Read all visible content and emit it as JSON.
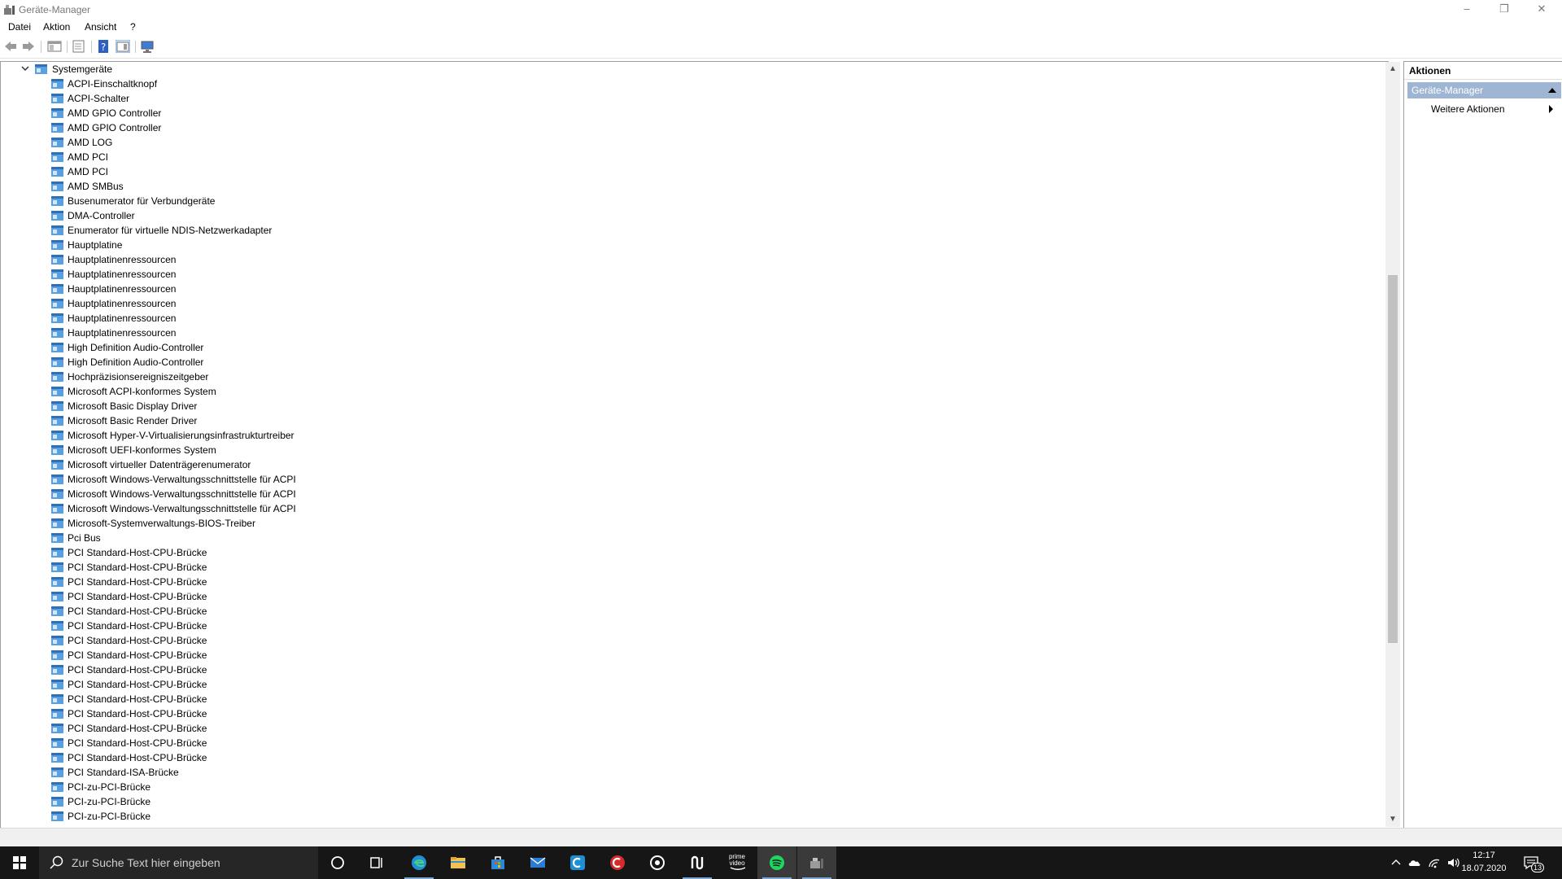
{
  "window": {
    "title": "Geräte-Manager",
    "controls": {
      "minimize": "–",
      "restore": "❐",
      "close": "✕"
    }
  },
  "menu": [
    "Datei",
    "Aktion",
    "Ansicht",
    "?"
  ],
  "toolbar": {
    "icons": [
      "back-icon",
      "forward-icon",
      "show-hide-console-tree-icon",
      "properties-icon",
      "help-icon",
      "show-hide-action-pane-icon",
      "scan-hardware-icon"
    ]
  },
  "tree": {
    "category": "Systemgeräte",
    "expanded": true,
    "devices": [
      "ACPI-Einschaltknopf",
      "ACPI-Schalter",
      "AMD GPIO Controller",
      "AMD GPIO Controller",
      "AMD LOG",
      "AMD PCI",
      "AMD PCI",
      "AMD SMBus",
      "Busenumerator für Verbundgeräte",
      "DMA-Controller",
      "Enumerator für virtuelle NDIS-Netzwerkadapter",
      "Hauptplatine",
      "Hauptplatinenressourcen",
      "Hauptplatinenressourcen",
      "Hauptplatinenressourcen",
      "Hauptplatinenressourcen",
      "Hauptplatinenressourcen",
      "Hauptplatinenressourcen",
      "High Definition Audio-Controller",
      "High Definition Audio-Controller",
      "Hochpräzisionsereigniszeitgeber",
      "Microsoft ACPI-konformes System",
      "Microsoft Basic Display Driver",
      "Microsoft Basic Render Driver",
      "Microsoft Hyper-V-Virtualisierungsinfrastrukturtreiber",
      "Microsoft UEFI-konformes System",
      "Microsoft virtueller Datenträgerenumerator",
      "Microsoft Windows-Verwaltungsschnittstelle für ACPI",
      "Microsoft Windows-Verwaltungsschnittstelle für ACPI",
      "Microsoft Windows-Verwaltungsschnittstelle für ACPI",
      "Microsoft-Systemverwaltungs-BIOS-Treiber",
      "Pci Bus",
      "PCI Standard-Host-CPU-Brücke",
      "PCI Standard-Host-CPU-Brücke",
      "PCI Standard-Host-CPU-Brücke",
      "PCI Standard-Host-CPU-Brücke",
      "PCI Standard-Host-CPU-Brücke",
      "PCI Standard-Host-CPU-Brücke",
      "PCI Standard-Host-CPU-Brücke",
      "PCI Standard-Host-CPU-Brücke",
      "PCI Standard-Host-CPU-Brücke",
      "PCI Standard-Host-CPU-Brücke",
      "PCI Standard-Host-CPU-Brücke",
      "PCI Standard-Host-CPU-Brücke",
      "PCI Standard-Host-CPU-Brücke",
      "PCI Standard-Host-CPU-Brücke",
      "PCI Standard-Host-CPU-Brücke",
      "PCI Standard-ISA-Brücke",
      "PCI-zu-PCI-Brücke",
      "PCI-zu-PCI-Brücke",
      "PCI-zu-PCI-Brücke"
    ]
  },
  "actions": {
    "header": "Aktionen",
    "section": "Geräte-Manager",
    "more": "Weitere Aktionen"
  },
  "taskbar": {
    "search_placeholder": "Zur Suche Text hier eingeben",
    "apps": [
      "cortana-icon",
      "task-view-icon",
      "edge-icon",
      "file-explorer-icon",
      "store-icon",
      "mail-icon",
      "ccleaner-icon",
      "antivirus-icon",
      "music-app-icon",
      "n-app-icon",
      "prime-video-icon",
      "spotify-icon",
      "device-manager-icon"
    ],
    "prime_video_label": "prime video",
    "clock_time": "12:17",
    "clock_date": "18.07.2020",
    "notification_count": "13"
  },
  "colors": {
    "accent": "#9eb6d3",
    "taskbar": "#161616",
    "spotify_active": "#3a3a3a"
  }
}
